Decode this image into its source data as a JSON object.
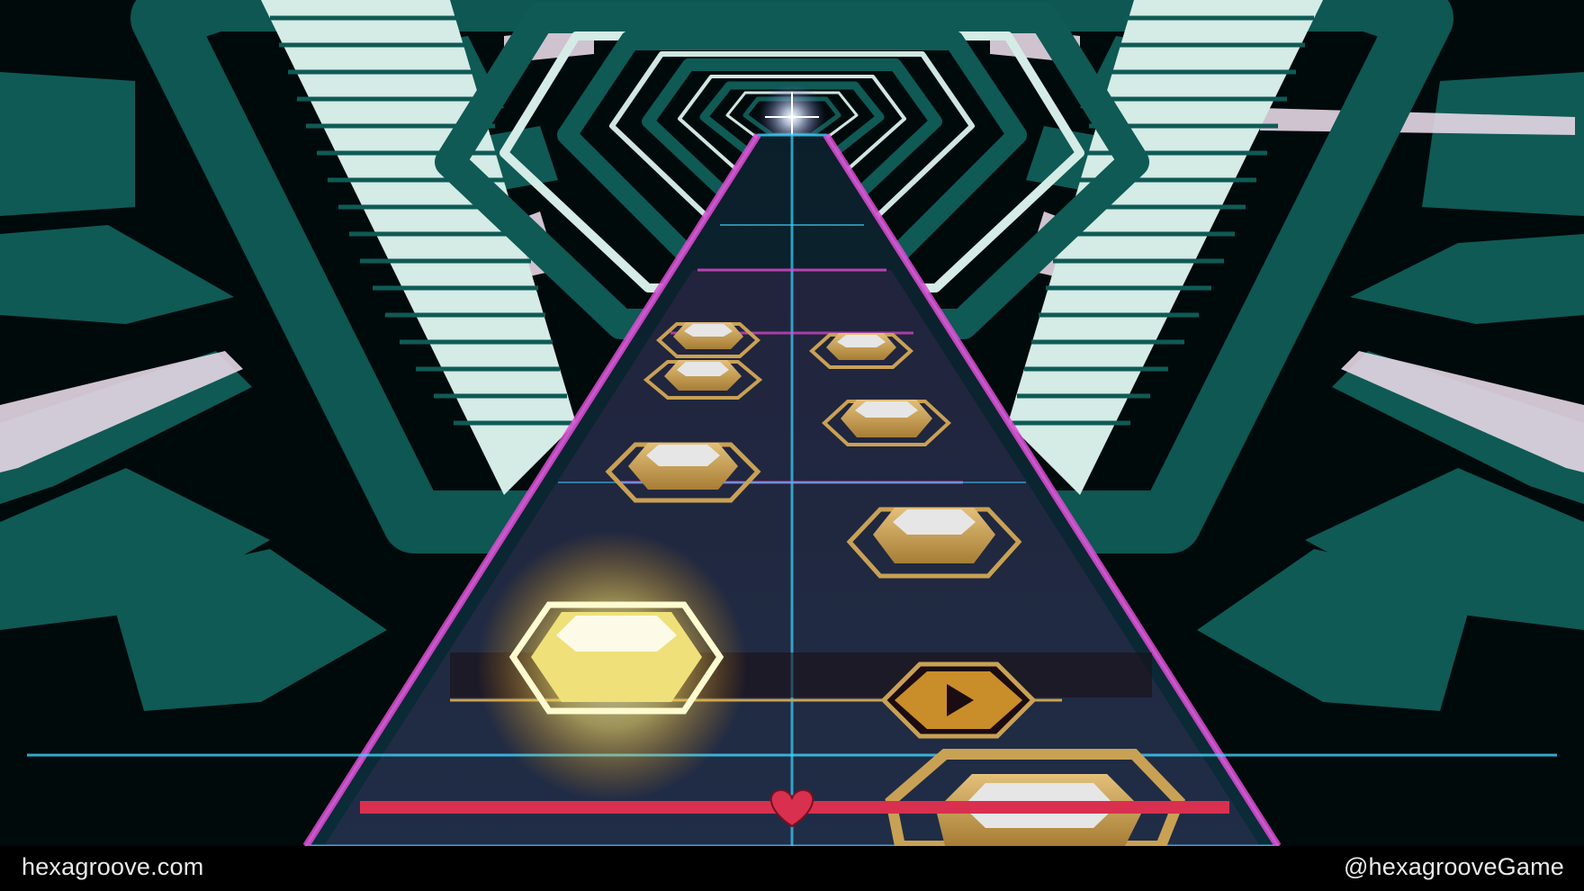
{
  "footer": {
    "website": "hexagroove.com",
    "handle": "@hexagrooveGame"
  },
  "game": {
    "hud": {
      "life_icon": "heart-icon",
      "play_marker_icon": "play-triangle-icon"
    },
    "notes_remaining_visible": 9,
    "colors": {
      "tunnel_teal": "#0f5a55",
      "tunnel_light": "#cfe9e4",
      "lane_magenta": "#e04bd0",
      "lane_cyan": "#3fd3ff",
      "note_gold": "#c9a154",
      "note_glow": "#fff07a",
      "life_bar_red": "#d9304f"
    }
  }
}
